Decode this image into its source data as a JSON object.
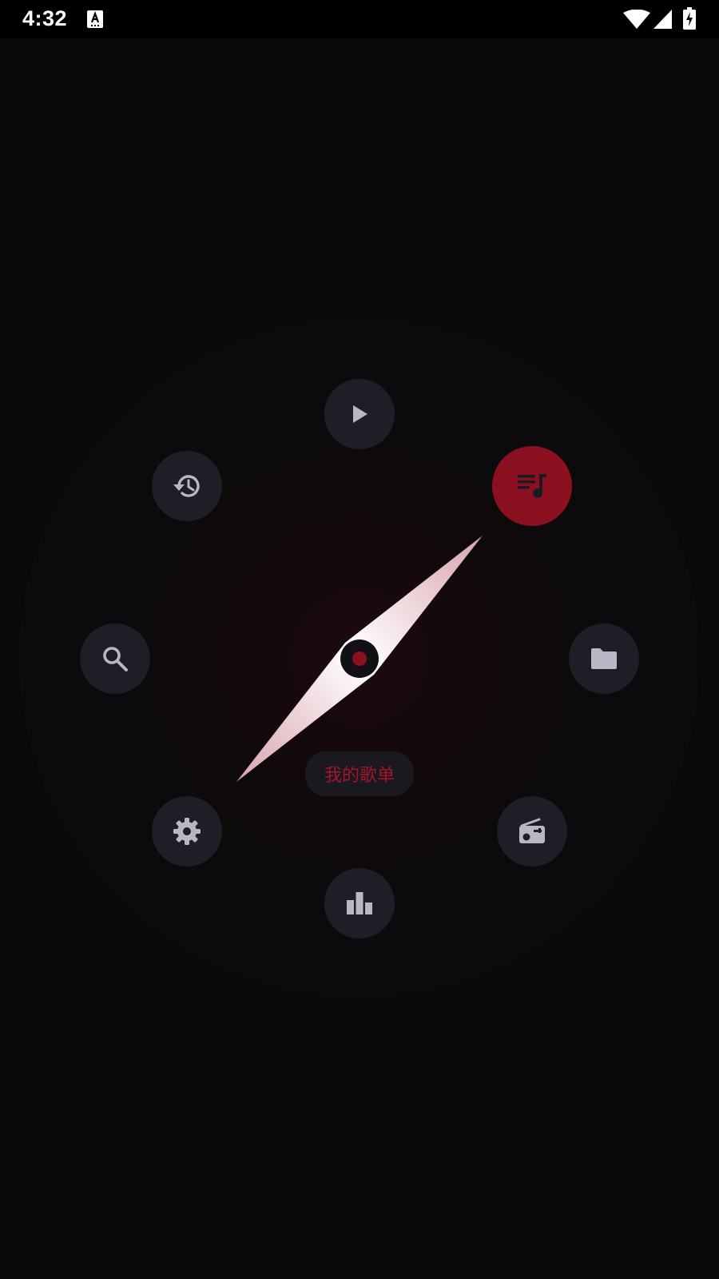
{
  "status_bar": {
    "time": "4:32",
    "icons": [
      "keyboard-a-notification-icon",
      "wifi-icon",
      "cellular-signal-icon",
      "battery-charging-icon"
    ]
  },
  "dial": {
    "selected_label": "我的歌单",
    "selected_item": "playlist",
    "items": [
      {
        "id": "play",
        "icon": "play-icon"
      },
      {
        "id": "playlist",
        "icon": "playlist-music-icon"
      },
      {
        "id": "folder",
        "icon": "folder-icon"
      },
      {
        "id": "radio",
        "icon": "radio-icon"
      },
      {
        "id": "chart",
        "icon": "bar-chart-icon"
      },
      {
        "id": "settings",
        "icon": "gear-icon"
      },
      {
        "id": "search",
        "icon": "search-icon"
      },
      {
        "id": "history",
        "icon": "history-icon"
      }
    ]
  },
  "colors": {
    "background": "#09090b",
    "status_bar": "#000000",
    "button": "#1f1e26",
    "accent": "#8b1020",
    "label_text": "#a3162b",
    "icon": "#b9b6c6"
  }
}
